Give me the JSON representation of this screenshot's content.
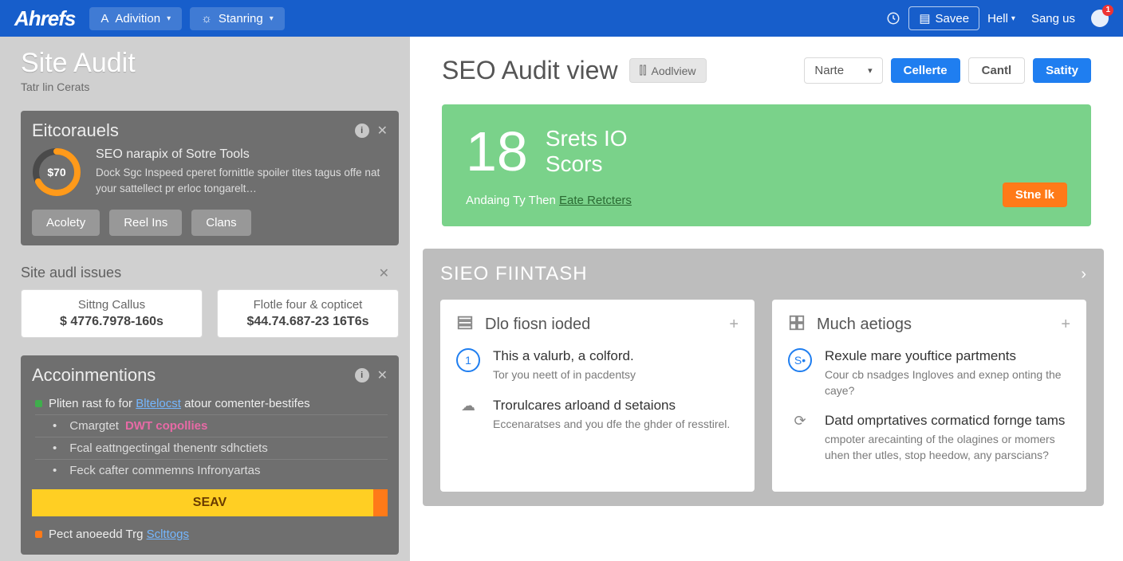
{
  "nav": {
    "brand": "Ahrefs",
    "items": [
      {
        "icon": "A",
        "label": "Adivition"
      },
      {
        "icon": "☼",
        "label": "Stanring"
      }
    ],
    "right": {
      "savee": "Savee",
      "hell": "Hell",
      "sangus": "Sang us",
      "badge": "1"
    }
  },
  "sidebar": {
    "title": "Site Audit",
    "sub": "Tatr lin Cerats",
    "eit": {
      "title": "Eitcorauels",
      "badge": "i",
      "score": "$70",
      "h": "SEO narapix of Sotre Tools",
      "p": "Dock Sgc Inspeed cperet fornittle spoiler tites tagus offe nat your sattellect pr erloc tongarelt…",
      "chips": [
        "Acolety",
        "Reel Ins",
        "Clans"
      ]
    },
    "issues": {
      "title": "Site audl issues",
      "cards": [
        {
          "lab": "Sittng Callus",
          "val": "$ 4776.7978-160s"
        },
        {
          "lab": "Flotle four & copticet",
          "val": "$44.74.687-23 16T6s"
        }
      ]
    },
    "accom": {
      "title": "Accoinmentions",
      "badge": "i",
      "line1_pre": "Pliten rast fo for ",
      "line1_link": "Bltelocst",
      "line1_post": " atour comenter-bestifes",
      "sub1_pre": "Cmargtet ",
      "sub1_hl": "DWT copollies",
      "sub2": "Fcal eattngectingal thenentr sdhctiets",
      "sub3": "Feck cafter commemns Infronyartas",
      "bar": "SEAV",
      "line2_pre": "Pect anoeedd Trg ",
      "line2_link": "Sclttogs"
    }
  },
  "main": {
    "title": "SEO Audit view",
    "pill": "Aodlview",
    "select": "Narte",
    "btn1": "Cellerte",
    "btn2": "Cantl",
    "btn3": "Satity",
    "score": {
      "big": "18",
      "label1": "Srets IO",
      "label2": "Scors",
      "bottom_pre": "Andaing Ty Then ",
      "bottom_link": "Eate Retcters",
      "cta": "Stne lk"
    },
    "grey": {
      "title": "SIEO FIINTASH",
      "left": {
        "title": "Dlo fiosn ioded",
        "items": [
          {
            "num": "1",
            "h": "This a valurb, a colford.",
            "p": "Tor you neett of in pacdentsy"
          },
          {
            "icon": "☁",
            "h": "Trorulcares arloand d setaions",
            "p": "Eccenaratses and you dfe the ghder of resstirel."
          }
        ]
      },
      "right": {
        "title": "Much aetiogs",
        "items": [
          {
            "num": "S•",
            "h": "Rexule mare youftice partments",
            "p": "Cour cb nsadges Ingloves and exnep onting the caye?"
          },
          {
            "icon": "⟳",
            "h": "Datd omprtatives cormaticd fornge tams",
            "p": "cmpoter arecainting of the olagines or momers uhen ther utles, stop heedow, any parscians?"
          }
        ]
      }
    }
  }
}
